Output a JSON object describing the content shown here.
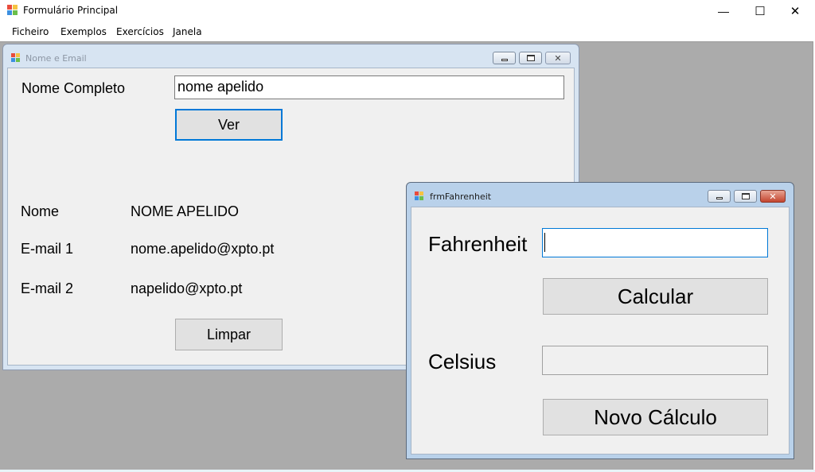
{
  "main_window": {
    "title": "Formulário Principal",
    "controls": {
      "minimize": "—",
      "maximize": "☐",
      "close": "✕"
    }
  },
  "menu": {
    "items": [
      "Ficheiro",
      "Exemplos",
      "Exercícios",
      "Janela"
    ]
  },
  "nome_email_window": {
    "title": "Nome e Email",
    "state": "inactive",
    "full_name_label": "Nome Completo",
    "full_name_value": "nome apelido",
    "ver_button": "Ver",
    "nome_label": "Nome",
    "nome_value": "NOME APELIDO",
    "email1_label": "E-mail 1",
    "email1_value": "nome.apelido@xpto.pt",
    "email2_label": "E-mail 2",
    "email2_value": "napelido@xpto.pt",
    "limpar_button": "Limpar"
  },
  "fahrenheit_window": {
    "title": "frmFahrenheit",
    "state": "active",
    "fahrenheit_label": "Fahrenheit",
    "fahrenheit_value": "",
    "calcular_button": "Calcular",
    "celsius_label": "Celsius",
    "celsius_value": "",
    "novo_button": "Novo Cálculo"
  },
  "colors": {
    "mdi_background": "#ababab",
    "focus_accent": "#0078d7",
    "close_button_active": "#c4452f"
  },
  "icons": [
    "app-icon",
    "minimize-icon",
    "maximize-icon",
    "restore-icon",
    "close-icon"
  ]
}
